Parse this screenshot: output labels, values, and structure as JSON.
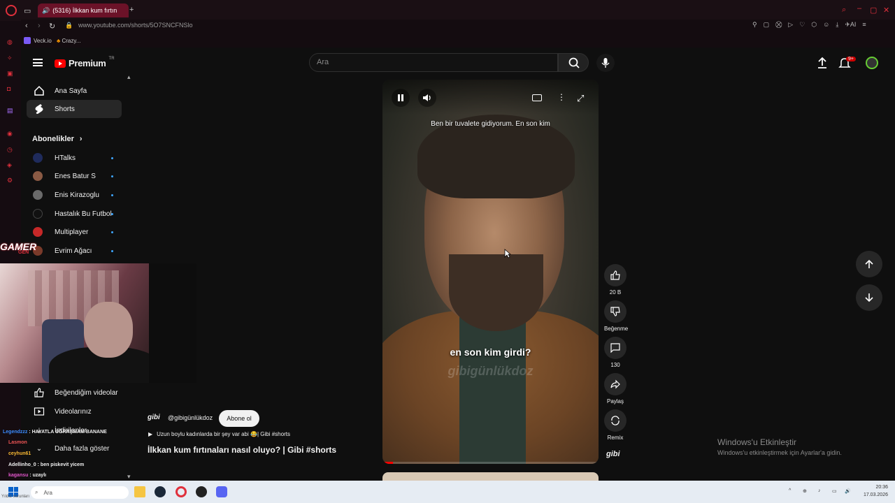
{
  "browser": {
    "tab_title": "(5316) İlkkan kum fırtın",
    "url": "www.youtube.com/shorts/5O7SNCFNSlo",
    "bookmarks": [
      "Veck.io",
      "Crazy..."
    ]
  },
  "youtube": {
    "logo_text": "Premium",
    "logo_region": "TR",
    "search_placeholder": "Ara",
    "notif_badge": "9+",
    "sidebar": {
      "items": [
        {
          "label": "Ana Sayfa"
        },
        {
          "label": "Shorts"
        }
      ],
      "subs_title": "Abonelikler",
      "subscriptions": [
        {
          "name": "HTalks"
        },
        {
          "name": "Enes Batur S"
        },
        {
          "name": "Enis Kirazoglu"
        },
        {
          "name": "Hastalık Bu Futbol"
        },
        {
          "name": "Multiplayer"
        },
        {
          "name": "Evrim Ağacı"
        }
      ],
      "more_items": [
        {
          "label": "Beğendiğim videolar"
        },
        {
          "label": "Videolarınız"
        },
        {
          "label": "İndirilenler"
        },
        {
          "label": "Daha fazla göster"
        }
      ]
    },
    "short": {
      "subtitle_top": "Ben bir tuvalete gidiyorum. En son kim",
      "subtitle_bottom": "en son kim girdi?",
      "watermark": "gibigünlükdoz",
      "progress": 0.05,
      "channel_logo": "gibi",
      "channel_handle": "@gibigünlükdoz",
      "subscribe_label": "Abone ol",
      "related_text": "Uzun boylu kadınlarda bir şey var abi 😂| Gibi #shorts",
      "title": "İlkkan kum fırtınaları nasıl oluyo? | Gibi #shorts"
    },
    "actions": {
      "like_count": "20 B",
      "dislike_label": "Beğenme",
      "comment_count": "130",
      "share_label": "Paylaş",
      "remix_label": "Remix",
      "channel_label": "gibi"
    }
  },
  "overlay": {
    "gamer_logo": "GAMER",
    "gamer_logo_sub": "GEN",
    "chat": [
      {
        "user": "Legendzzz",
        "msg": "HAYATLA UĞRAŞMAM BANANE"
      },
      {
        "user": "Lasmon",
        "msg": ""
      },
      {
        "user": "ceyhun61",
        "msg": ""
      },
      {
        "user": "Adellinho_0",
        "msg": "ben piskevit yicem"
      },
      {
        "user": "kagansu",
        "msg": "uzaylı"
      }
    ]
  },
  "windows": {
    "activate_title": "Windows'u Etkinleştir",
    "activate_sub": "Windows'u etkinleştirmek için Ayarlar'a gidin.",
    "taskbar_search": "Ara",
    "clock_time": "20:36",
    "clock_date": "17.03.2026",
    "bottom_left": "Yıldız sorunları"
  }
}
